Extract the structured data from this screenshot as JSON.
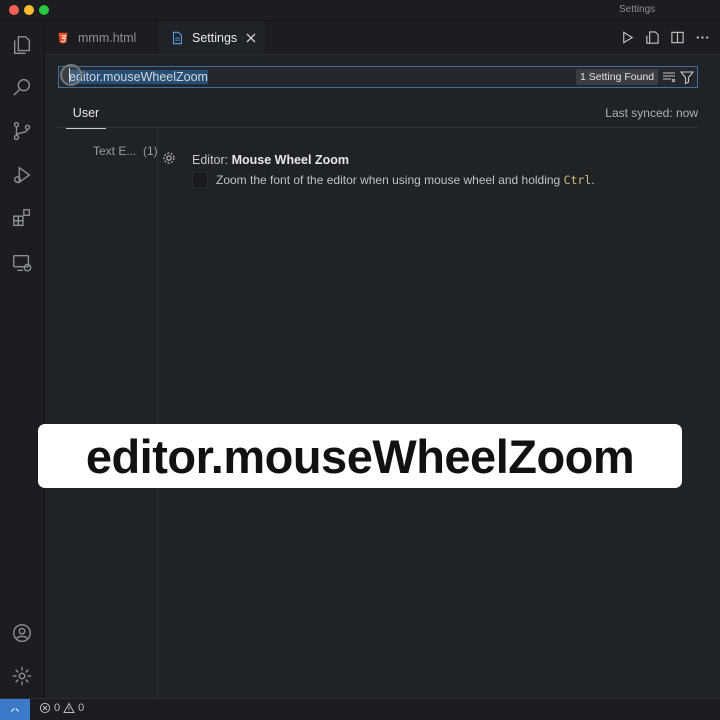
{
  "window": {
    "title": "Settings"
  },
  "tabs": [
    {
      "label": "mmm.html",
      "icon": "html5-icon"
    },
    {
      "label": "Settings",
      "icon": "file-icon",
      "close": "close-icon"
    }
  ],
  "search": {
    "value": "editor.mouseWheelZoom",
    "results_badge": "1 Setting Found"
  },
  "scope": {
    "user_tab": "User",
    "last_synced": "Last synced: now"
  },
  "toc": {
    "item": "Text E...",
    "count": "(1)"
  },
  "setting": {
    "category": "Editor: ",
    "name": "Mouse Wheel Zoom",
    "description": "Zoom the font of the editor when using mouse wheel and holding ",
    "key": "Ctrl",
    "description_end": ".",
    "checked": false
  },
  "caption": "editor.mouseWheelZoom",
  "status": {
    "errors": "0",
    "warnings": "0"
  },
  "colors": {
    "accent": "#3b79c9",
    "background": "#1f2227",
    "caption_bg": "#ffffff"
  }
}
